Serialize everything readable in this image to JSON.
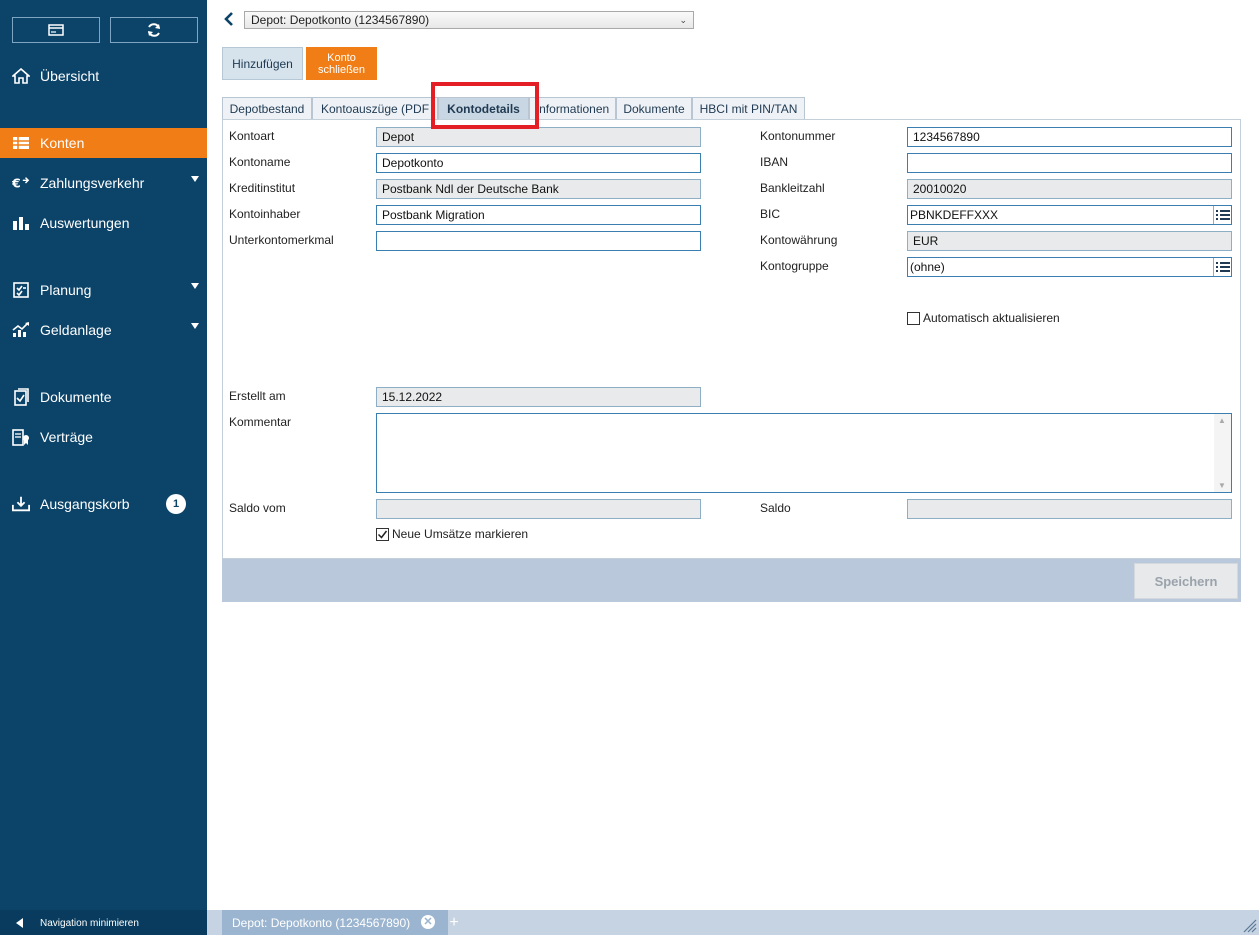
{
  "sidebar": {
    "top_buttons": [
      {
        "icon": "card-icon"
      },
      {
        "icon": "refresh-icon"
      }
    ],
    "items": [
      {
        "label": "Übersicht",
        "icon": "home-icon",
        "active": false,
        "submenu": false
      },
      {
        "label": "Konten",
        "icon": "accounts-icon",
        "active": true,
        "submenu": false
      },
      {
        "label": "Zahlungsverkehr",
        "icon": "euro-transfer-icon",
        "active": false,
        "submenu": true
      },
      {
        "label": "Auswertungen",
        "icon": "bar-chart-icon",
        "active": false,
        "submenu": false
      },
      {
        "label": "Planung",
        "icon": "planning-icon",
        "active": false,
        "submenu": true
      },
      {
        "label": "Geldanlage",
        "icon": "investment-chart-icon",
        "active": false,
        "submenu": true
      },
      {
        "label": "Dokumente",
        "icon": "documents-icon",
        "active": false,
        "submenu": false
      },
      {
        "label": "Verträge",
        "icon": "contracts-icon",
        "active": false,
        "submenu": false
      },
      {
        "label": "Ausgangskorb",
        "icon": "outbox-icon",
        "active": false,
        "submenu": false,
        "badge": "1"
      }
    ],
    "minimize_label": "Navigation minimieren"
  },
  "header": {
    "account_select_value": "Depot: Depotkonto (1234567890)",
    "add_button": "Hinzufügen",
    "close_account_button": "Konto\nschließen"
  },
  "tabs": [
    {
      "label": "Depotbestand",
      "active": false
    },
    {
      "label": "Kontoauszüge (PDF",
      "active": false
    },
    {
      "label": "Kontodetails",
      "active": true
    },
    {
      "label": "Informationen",
      "active": false
    },
    {
      "label": "Dokumente",
      "active": false
    },
    {
      "label": "HBCI mit PIN/TAN",
      "active": false
    }
  ],
  "form": {
    "left": [
      {
        "label": "Kontoart",
        "value": "Depot",
        "readonly": true
      },
      {
        "label": "Kontoname",
        "value": "Depotkonto",
        "readonly": false
      },
      {
        "label": "Kreditinstitut",
        "value": "Postbank Ndl der Deutsche Bank",
        "readonly": true
      },
      {
        "label": "Kontoinhaber",
        "value": "Postbank Migration",
        "readonly": false
      },
      {
        "label": "Unterkontomerkmal",
        "value": "",
        "readonly": false
      }
    ],
    "right": [
      {
        "label": "Kontonummer",
        "value": "1234567890",
        "readonly": false
      },
      {
        "label": "IBAN",
        "value": "",
        "readonly": false
      },
      {
        "label": "Bankleitzahl",
        "value": "20010020",
        "readonly": true
      },
      {
        "label": "BIC",
        "value": "PBNKDEFFXXX",
        "readonly": false,
        "list_button": true
      },
      {
        "label": "Kontowährung",
        "value": "EUR",
        "readonly": true
      },
      {
        "label": "Kontogruppe",
        "value": "(ohne)",
        "readonly": false,
        "list_button": true
      }
    ],
    "auto_update_label": "Automatisch aktualisieren",
    "auto_update_checked": false,
    "created_label": "Erstellt am",
    "created_value": "15.12.2022",
    "comment_label": "Kommentar",
    "comment_value": "",
    "balance_date_label": "Saldo vom",
    "balance_date_value": "",
    "balance_label": "Saldo",
    "balance_value": "",
    "mark_new_label": "Neue Umsätze markieren",
    "mark_new_checked": true
  },
  "footer": {
    "save_button": "Speichern"
  },
  "bottom_tabs": {
    "doc_tab_label": "Depot: Depotkonto (1234567890)",
    "close_symbol": "✕",
    "add_symbol": "+"
  },
  "colors": {
    "sidebar_bg": "#0b4369",
    "accent_orange": "#f07d16",
    "highlight_red": "#e31e24"
  }
}
